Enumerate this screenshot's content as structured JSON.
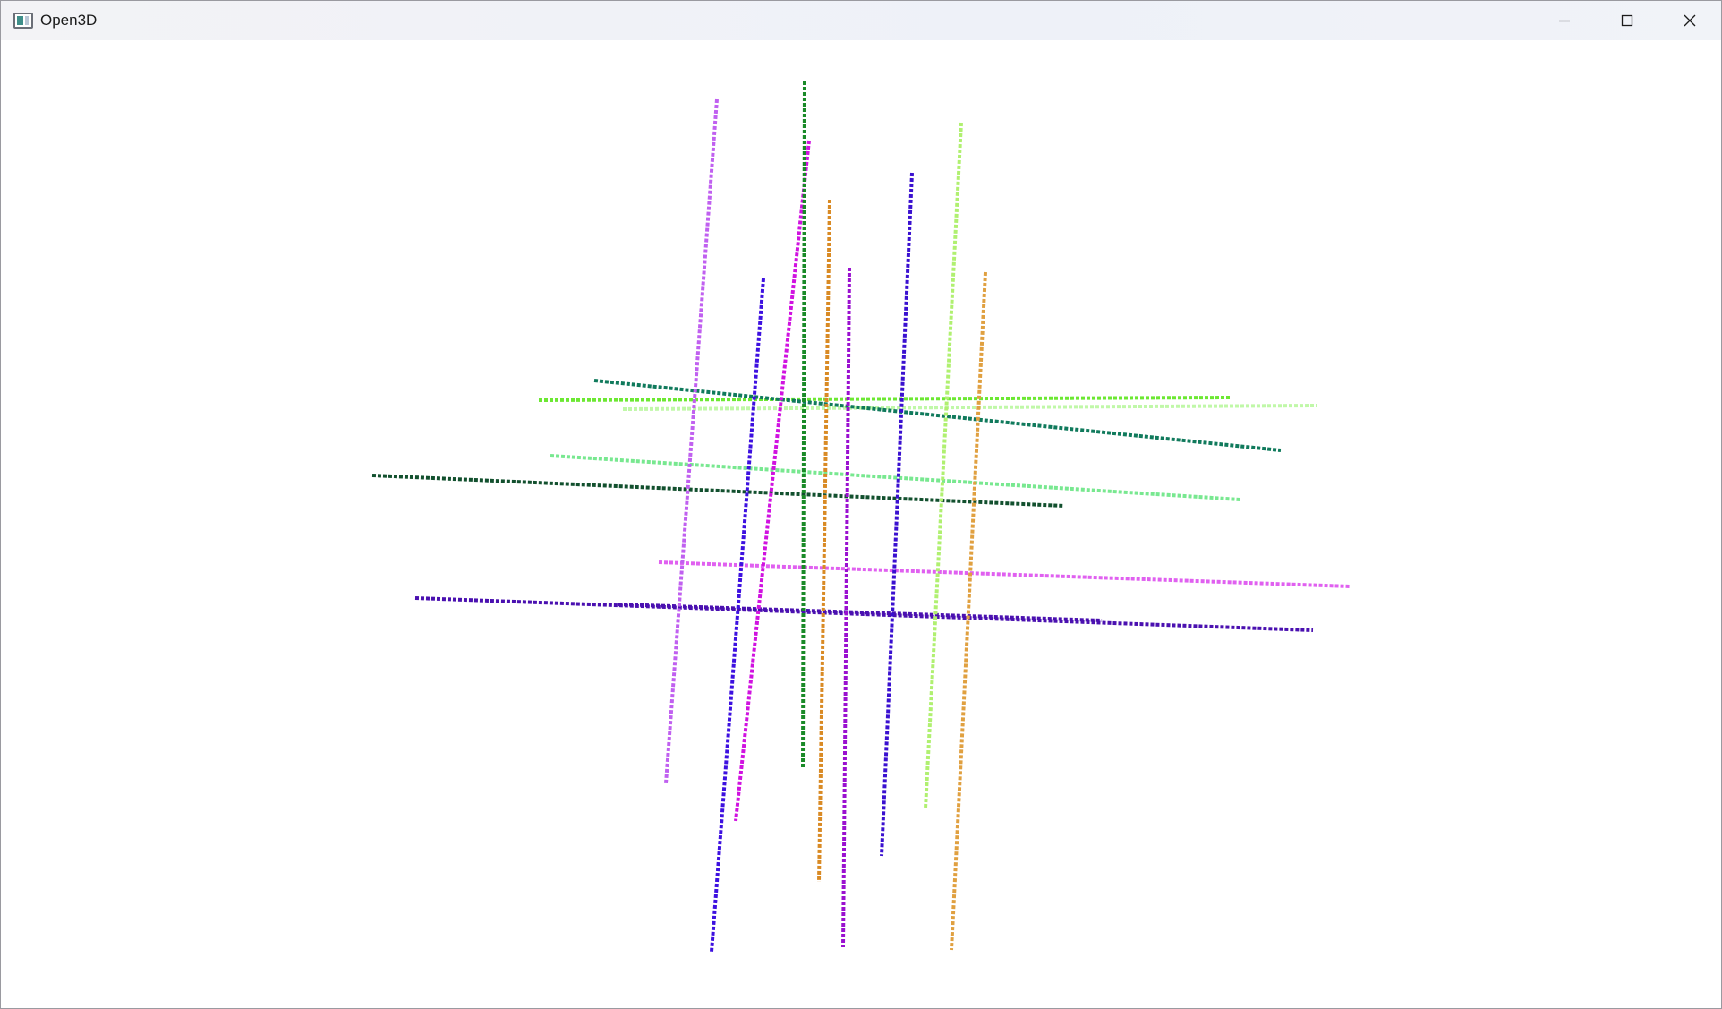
{
  "window": {
    "title": "Open3D",
    "icon": "open3d-app-icon"
  },
  "caption_buttons": [
    {
      "name": "minimize-button",
      "icon": "minimize-icon"
    },
    {
      "name": "maximize-button",
      "icon": "maximize-icon"
    },
    {
      "name": "close-button",
      "icon": "close-icon"
    }
  ],
  "scene": {
    "background_color": "#ffffff",
    "vertical_lines": [
      {
        "color": "#c060f0"
      },
      {
        "color": "#3d10e0"
      },
      {
        "color": "#d012e0"
      },
      {
        "color": "#1a8a28"
      },
      {
        "color": "#d98a24"
      },
      {
        "color": "#9a10d0"
      },
      {
        "color": "#3a10d0"
      },
      {
        "color": "#b0f070"
      },
      {
        "color": "#e0a040"
      }
    ],
    "horizontal_lines": [
      {
        "color": "#6ce832"
      },
      {
        "color": "#c0f8a8"
      },
      {
        "color": "#107a5c"
      },
      {
        "color": "#78e890"
      },
      {
        "color": "#12502e"
      },
      {
        "color": "#e060f0"
      },
      {
        "color": "#4a10b0"
      },
      {
        "color": "#4a10b0"
      }
    ]
  }
}
